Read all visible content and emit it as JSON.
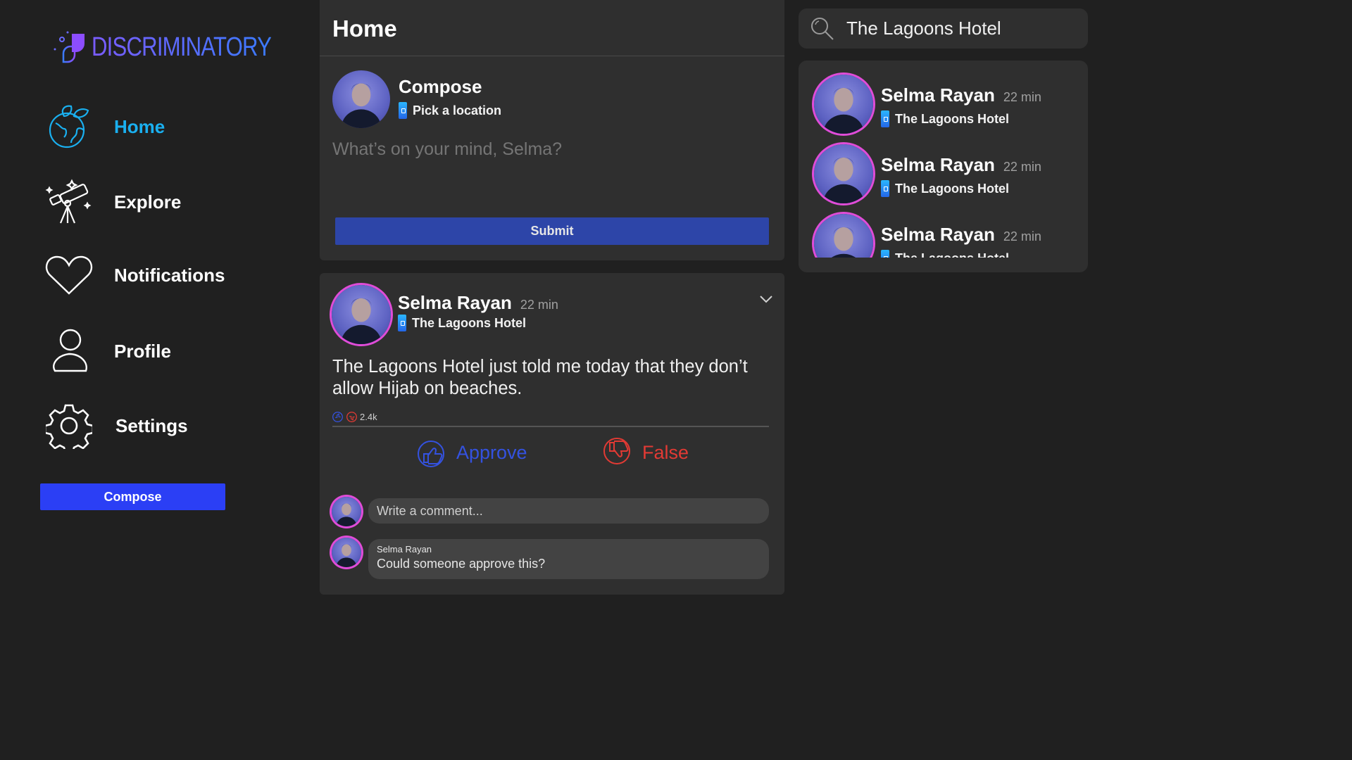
{
  "brand": {
    "name": "DISCRIMINATORY"
  },
  "nav": {
    "items": [
      {
        "label": "Home",
        "icon": "globe-leaf-icon",
        "active": true
      },
      {
        "label": "Explore",
        "icon": "telescope-icon",
        "active": false
      },
      {
        "label": "Notifications",
        "icon": "heart-icon",
        "active": false
      },
      {
        "label": "Profile",
        "icon": "user-icon",
        "active": false
      },
      {
        "label": "Settings",
        "icon": "gear-icon",
        "active": false
      }
    ],
    "compose_label": "Compose"
  },
  "home": {
    "title": "Home",
    "compose": {
      "title": "Compose",
      "location_label": "Pick a location",
      "placeholder": "What’s on your mind, Selma?",
      "submit_label": "Submit"
    }
  },
  "post": {
    "author": "Selma Rayan",
    "time": "22 min",
    "location": "The Lagoons Hotel",
    "text": "The Lagoons Hotel just told me today that they don’t allow Hijab on beaches.",
    "reaction_count": "2.4k",
    "approve_label": "Approve",
    "false_label": "False",
    "comment_placeholder": "Write a comment...",
    "comments": [
      {
        "author": "Selma Rayan",
        "text": "Could someone approve this?"
      }
    ]
  },
  "search": {
    "value": "The Lagoons Hotel",
    "results": [
      {
        "author": "Selma Rayan",
        "time": "22 min",
        "location": "The Lagoons Hotel"
      },
      {
        "author": "Selma Rayan",
        "time": "22 min",
        "location": "The Lagoons Hotel"
      },
      {
        "author": "Selma Rayan",
        "time": "22 min",
        "location": "The Lagoons Hotel"
      }
    ]
  },
  "colors": {
    "background": "#202020",
    "card": "#2f2f2f",
    "accent_blue": "#2b3ff5",
    "active_nav": "#1ab0f0",
    "approve": "#3452e0",
    "false": "#e23a34",
    "avatar_ring": "#e04cd8"
  }
}
